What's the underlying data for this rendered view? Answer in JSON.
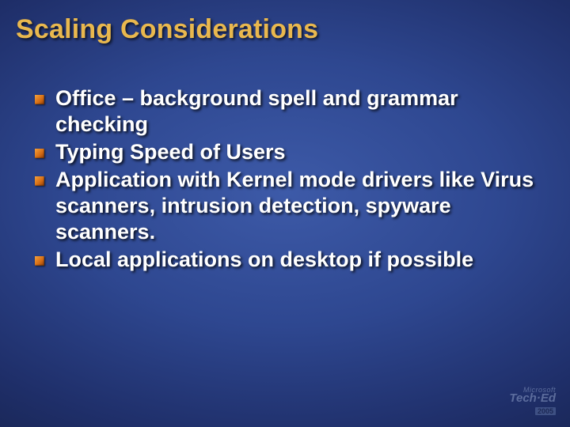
{
  "title": "Scaling Considerations",
  "bullets": [
    "Office – background spell and grammar checking",
    "Typing Speed of Users",
    "Application with Kernel mode drivers like Virus scanners, intrusion detection, spyware scanners.",
    "Local applications on desktop if possible"
  ],
  "footer": {
    "brand_small": "Microsoft",
    "brand_main": "Tech·Ed",
    "year": "2005"
  }
}
